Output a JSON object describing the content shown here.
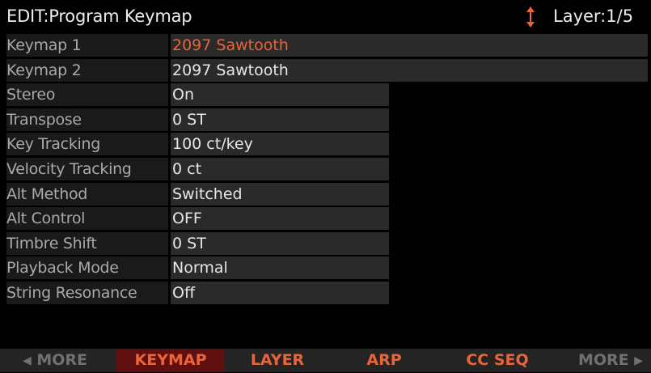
{
  "header": {
    "title": "EDIT:Program Keymap",
    "layer": "Layer:1/5",
    "updown_icon": "up-down-arrows-icon",
    "accent_color": "#e8643a"
  },
  "params": [
    {
      "label": "Keymap 1",
      "value": "2097 Sawtooth"
    },
    {
      "label": "Keymap 2",
      "value": "2097 Sawtooth"
    },
    {
      "label": "Stereo",
      "value": "On"
    },
    {
      "label": "Transpose",
      "value": "0 ST"
    },
    {
      "label": "Key Tracking",
      "value": "100 ct/key"
    },
    {
      "label": "Velocity Tracking",
      "value": "0 ct"
    },
    {
      "label": "Alt Method",
      "value": "Switched"
    },
    {
      "label": "Alt Control",
      "value": "OFF"
    },
    {
      "label": "Timbre Shift",
      "value": "0 ST"
    },
    {
      "label": "Playback Mode",
      "value": "Normal"
    },
    {
      "label": "String Resonance",
      "value": "Off"
    }
  ],
  "softbuttons": {
    "more_left": "MORE",
    "keymap": "KEYMAP",
    "layer": "LAYER",
    "arp": "ARP",
    "ccseq": "CC SEQ",
    "more_right": "MORE",
    "active_color": "#5e0f0f"
  }
}
